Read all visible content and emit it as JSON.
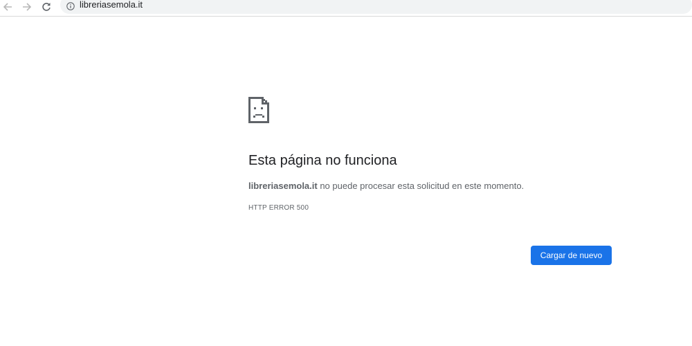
{
  "browser": {
    "url": "libreriasemola.it",
    "icons": {
      "back": "arrow-left-icon",
      "forward": "arrow-right-icon",
      "reload": "reload-icon",
      "info": "info-circle-icon"
    }
  },
  "error_page": {
    "icon": "sad-page-icon",
    "title": "Esta página no funciona",
    "description_host": "libreriasemola.it",
    "description_rest": " no puede procesar esta solicitud en este momento.",
    "error_code": "HTTP ERROR 500",
    "reload_button_label": "Cargar de nuevo"
  },
  "colors": {
    "button_blue": "#1a73e8",
    "text_primary": "#202124",
    "text_secondary": "#5f6368",
    "omnibox_bg": "#f1f3f4"
  }
}
